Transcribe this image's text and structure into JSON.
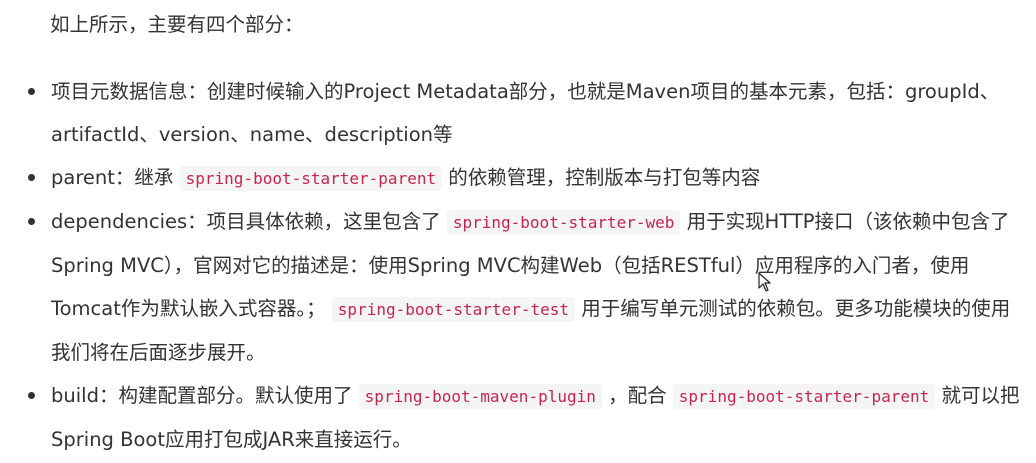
{
  "intro": "如上所示，主要有四个部分：",
  "items": [
    {
      "term": "项目元数据信息",
      "text": "：创建时候输入的Project Metadata部分，也就是Maven项目的基本元素，包括：groupId、artifactId、version、name、description等"
    },
    {
      "term": "parent",
      "before_code": "：继承",
      "code": "spring-boot-starter-parent",
      "after_code": "的依赖管理，控制版本与打包等内容"
    },
    {
      "term": "dependencies",
      "before_code": "：项目具体依赖，这里包含了",
      "code": "spring-boot-starter-web",
      "middle": "用于实现HTTP接口（该依赖中包含了Spring MVC），官网对它的描述是：使用Spring MVC构建Web（包括RESTful）应用程序的入门者，使用Tomcat作为默认嵌入式容器。；",
      "code2": "spring-boot-starter-test",
      "after_code": "用于编写单元测试的依赖包。更多功能模块的使用我们将在后面逐步展开。"
    },
    {
      "term": "build",
      "before_code": "：构建配置部分。默认使用了",
      "code": "spring-boot-maven-plugin",
      "middle": "，配合",
      "code2": "spring-boot-starter-parent",
      "after_code": "就可以把Spring Boot应用打包成JAR来直接运行。"
    }
  ],
  "colors": {
    "text": "#333333",
    "code_text": "#c7254e",
    "code_bg": "#f5f5f5"
  },
  "cursor_icon": "mouse-pointer-icon"
}
